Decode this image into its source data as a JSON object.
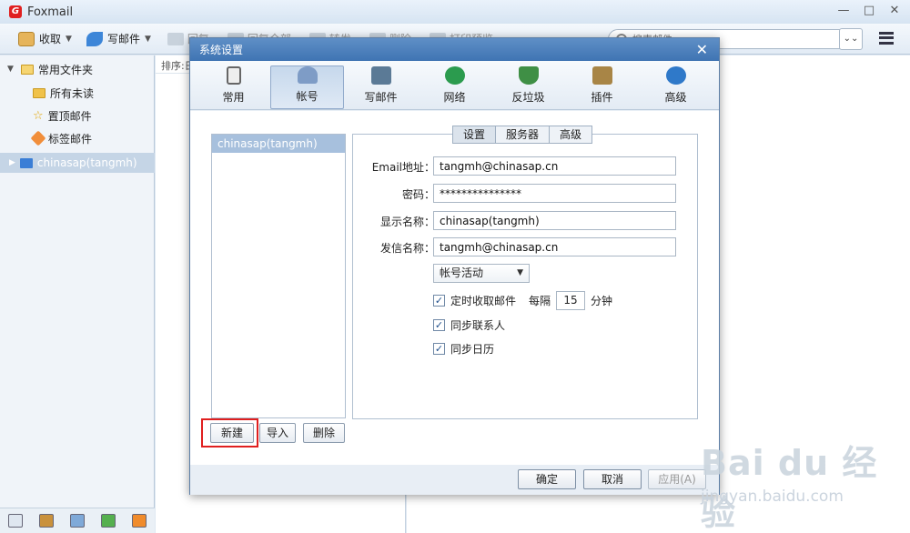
{
  "app": {
    "title": "Foxmail"
  },
  "window_controls": {
    "minimize": "—",
    "maximize": "□",
    "close": "✕"
  },
  "toolbar": {
    "receive_label": "收取",
    "compose_label": "写邮件",
    "faded": [
      "回复",
      "回复全部",
      "转发",
      "删除",
      "打印预览"
    ],
    "search_placeholder": "搜索邮件",
    "search_drop": "⌄⌄"
  },
  "sidebar": {
    "common_folders": "常用文件夹",
    "items": [
      {
        "label": "所有未读"
      },
      {
        "label": "置顶邮件"
      },
      {
        "label": "标签邮件"
      }
    ],
    "account": "chinasap(tangmh)"
  },
  "list": {
    "sort_label": "排序:日"
  },
  "dialog": {
    "title": "系统设置",
    "close": "✕",
    "tabs": [
      {
        "label": "常用",
        "icon": "phone-icon",
        "color": "#6b6b6b"
      },
      {
        "label": "帐号",
        "icon": "user-icon",
        "color": "#4a6b9a"
      },
      {
        "label": "写邮件",
        "icon": "pen-icon",
        "color": "#4f6e8a"
      },
      {
        "label": "网络",
        "icon": "globe-icon",
        "color": "#2b9b4e"
      },
      {
        "label": "反垃圾",
        "icon": "shield-icon",
        "color": "#3f8f45"
      },
      {
        "label": "插件",
        "icon": "box-icon",
        "color": "#8a6d3b"
      },
      {
        "label": "高级",
        "icon": "gear-icon",
        "color": "#2f79c9"
      }
    ],
    "account_list": [
      "chinasap(tangmh)"
    ],
    "buttons": {
      "new": "新建",
      "import": "导入",
      "delete": "删除"
    },
    "sub_tabs": [
      "设置",
      "服务器",
      "高级"
    ],
    "form": {
      "email_label": "Email地址：",
      "email_value": "tangmh@chinasap.cn",
      "password_label": "密码：",
      "password_value": "***************",
      "display_label": "显示名称：",
      "display_value": "chinasap(tangmh)",
      "sender_label": "发信名称：",
      "sender_value": "tangmh@chinasap.cn",
      "status_select": "帐号活动",
      "auto_receive": "定时收取邮件",
      "every": "每隔",
      "interval": "15",
      "minutes": "分钟",
      "sync_contacts": "同步联系人",
      "sync_calendar": "同步日历"
    },
    "footer": {
      "ok": "确定",
      "cancel": "取消",
      "apply": "应用(A)"
    }
  },
  "watermark": {
    "logo": "Bai du 经验",
    "url": "jingyan.baidu.com"
  }
}
